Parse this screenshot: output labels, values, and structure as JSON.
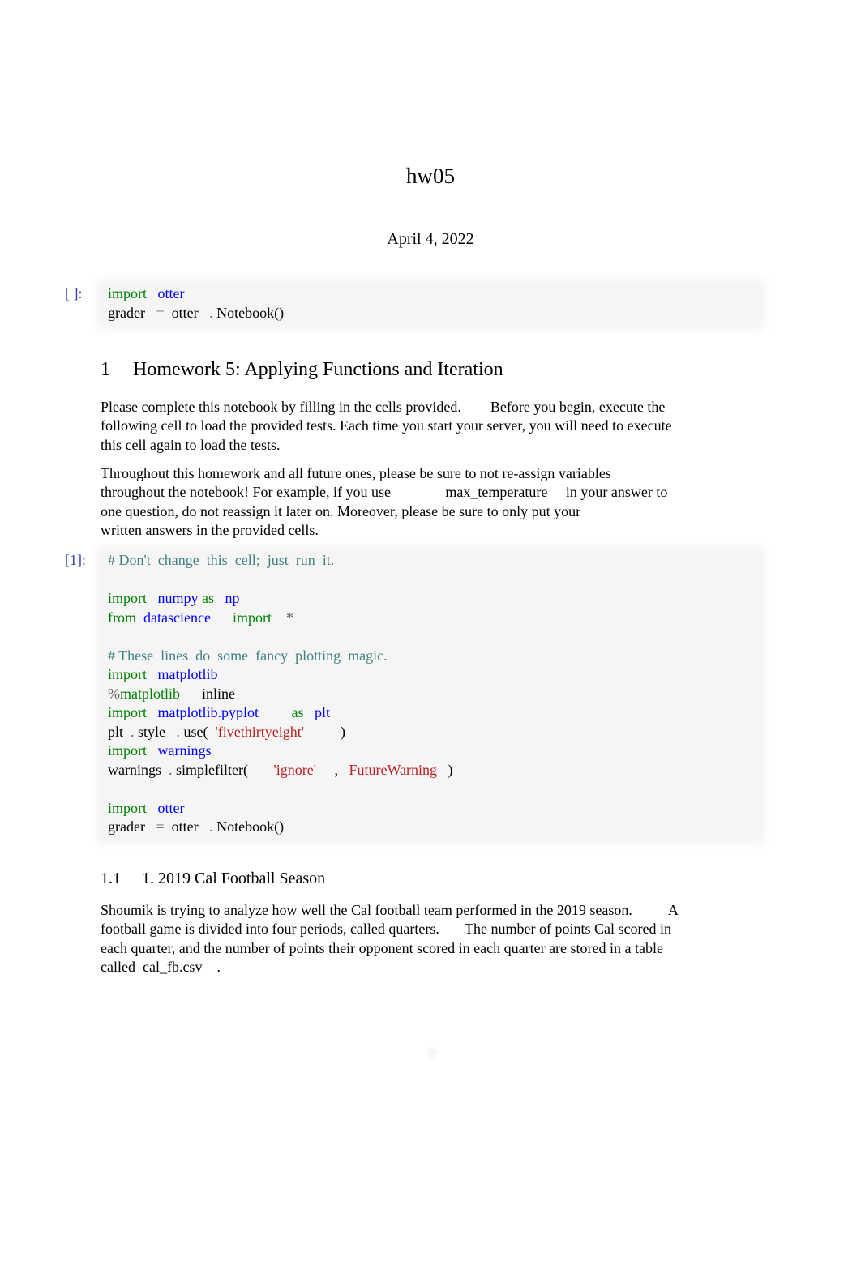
{
  "document": {
    "title": "hw05",
    "date": "April 4, 2022"
  },
  "cell0": {
    "prompt": "[ ]:",
    "lines": [
      [
        {
          "t": "import",
          "c": "kw"
        },
        {
          "t": "   "
        },
        {
          "t": "otter",
          "c": "nm"
        }
      ],
      [
        {
          "t": "grader"
        },
        {
          "t": "   "
        },
        {
          "t": "=",
          "c": "op"
        },
        {
          "t": "  otter   "
        },
        {
          "t": ".",
          "c": "op"
        },
        {
          "t": " Notebook()"
        }
      ]
    ]
  },
  "section1": {
    "number": "1",
    "title": "Homework 5: Applying Functions and Iteration",
    "para1": [
      "Please complete this notebook by filling in the cells provided.        Before you begin, execute the",
      "following cell to load the provided tests. Each time you start your server, you will need to execute",
      "this cell again to load the tests."
    ],
    "para2": [
      "Throughout this homework and all future ones, please be sure to not re-assign variables",
      "throughout the notebook! For example, if you use               max_temperature     in your answer to",
      "one question, do not reassign it later on. Moreover, please be sure to only put your",
      "written answers in the provided cells."
    ]
  },
  "cell1": {
    "prompt": "[1]:",
    "lines": [
      [
        {
          "t": "# Don't  change  this  cell;  just  run  it.",
          "c": "cm"
        }
      ],
      [],
      [
        {
          "t": "import",
          "c": "kw"
        },
        {
          "t": "   "
        },
        {
          "t": "numpy",
          "c": "nm"
        },
        {
          "t": " "
        },
        {
          "t": "as",
          "c": "kw"
        },
        {
          "t": "   "
        },
        {
          "t": "np",
          "c": "nm"
        }
      ],
      [
        {
          "t": "from",
          "c": "kw"
        },
        {
          "t": "  "
        },
        {
          "t": "datascience",
          "c": "nm"
        },
        {
          "t": "      "
        },
        {
          "t": "import",
          "c": "kw"
        },
        {
          "t": "    "
        },
        {
          "t": "*",
          "c": "op"
        }
      ],
      [],
      [
        {
          "t": "# These  lines  do  some  fancy  plotting  magic.",
          "c": "cm"
        }
      ],
      [
        {
          "t": "import",
          "c": "kw"
        },
        {
          "t": "   "
        },
        {
          "t": "matplotlib",
          "c": "nm"
        }
      ],
      [
        {
          "t": "%",
          "c": "op"
        },
        {
          "t": "matplotlib",
          "c": "kw"
        },
        {
          "t": "      inline"
        }
      ],
      [
        {
          "t": "import",
          "c": "kw"
        },
        {
          "t": "   "
        },
        {
          "t": "matplotlib.pyplot",
          "c": "nm"
        },
        {
          "t": "         "
        },
        {
          "t": "as",
          "c": "kw"
        },
        {
          "t": "   "
        },
        {
          "t": "plt",
          "c": "nm"
        }
      ],
      [
        {
          "t": "plt  "
        },
        {
          "t": ".",
          "c": "op"
        },
        {
          "t": " style   "
        },
        {
          "t": ".",
          "c": "op"
        },
        {
          "t": " use(  "
        },
        {
          "t": "'fivethirtyeight'",
          "c": "st"
        },
        {
          "t": "          )"
        }
      ],
      [
        {
          "t": "import",
          "c": "kw"
        },
        {
          "t": "   "
        },
        {
          "t": "warnings",
          "c": "nm"
        }
      ],
      [
        {
          "t": "warnings  "
        },
        {
          "t": ".",
          "c": "op"
        },
        {
          "t": " simplefilter(       "
        },
        {
          "t": "'ignore'",
          "c": "st"
        },
        {
          "t": "     ,   "
        },
        {
          "t": "FutureWarning",
          "c": "st"
        },
        {
          "t": "   )"
        }
      ],
      [],
      [
        {
          "t": "import",
          "c": "kw"
        },
        {
          "t": "   "
        },
        {
          "t": "otter",
          "c": "nm"
        }
      ],
      [
        {
          "t": "grader"
        },
        {
          "t": "   "
        },
        {
          "t": "=",
          "c": "op"
        },
        {
          "t": "  otter   "
        },
        {
          "t": ".",
          "c": "op"
        },
        {
          "t": " Notebook()"
        }
      ]
    ]
  },
  "section1_1": {
    "number": "1.1",
    "title": "1. 2019 Cal Football Season",
    "para": [
      "Shoumik is trying to analyze how well the Cal football team performed in the 2019 season.          A",
      "football game is divided into four periods, called quarters.       The number of points Cal scored in",
      "each quarter, and the number of points their opponent scored in each quarter are stored in a table",
      "called  cal_fb.csv    ."
    ]
  }
}
